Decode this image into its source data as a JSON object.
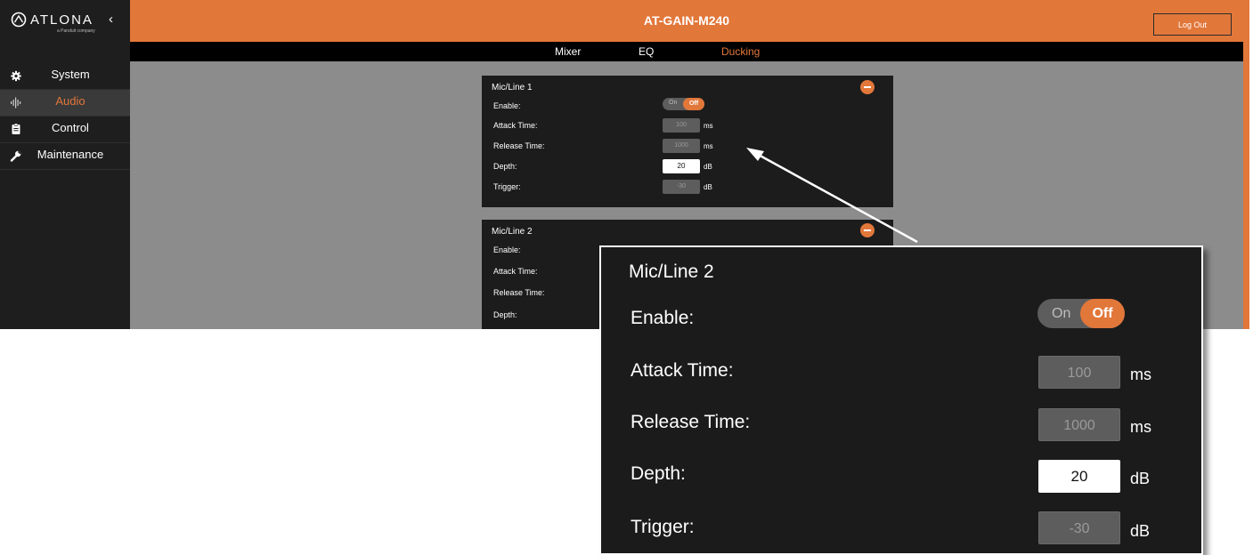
{
  "brand": {
    "logo_text": "ATLONA",
    "logo_subtitle": "a Panduit company",
    "collapse_glyph": "‹"
  },
  "header": {
    "title": "AT-GAIN-M240",
    "logout_label": "Log Out"
  },
  "sidebar": {
    "items": [
      {
        "label": "System",
        "icon": "gear-icon",
        "active": false
      },
      {
        "label": "Audio",
        "icon": "audio-waveform-icon",
        "active": true
      },
      {
        "label": "Control",
        "icon": "clipboard-icon",
        "active": false
      },
      {
        "label": "Maintenance",
        "icon": "wrench-icon",
        "active": false
      }
    ]
  },
  "tabs": [
    {
      "label": "Mixer",
      "active": false
    },
    {
      "label": "EQ",
      "active": false
    },
    {
      "label": "Ducking",
      "active": true
    }
  ],
  "channels": [
    {
      "title": "Mic/Line 1",
      "enable_label": "Enable:",
      "toggle": {
        "on": "On",
        "off": "Off",
        "state": "Off"
      },
      "attack_label": "Attack Time:",
      "attack_value": "100",
      "attack_unit": "ms",
      "release_label": "Release Time:",
      "release_value": "1000",
      "release_unit": "ms",
      "depth_label": "Depth:",
      "depth_value": "20",
      "depth_unit": "dB",
      "trigger_label": "Trigger:",
      "trigger_value": "-30",
      "trigger_unit": "dB"
    },
    {
      "title": "Mic/Line 2",
      "enable_label": "Enable:",
      "attack_label": "Attack Time:",
      "release_label": "Release Time:",
      "depth_label": "Depth:"
    }
  ],
  "zoom": {
    "title": "Mic/Line 2",
    "enable_label": "Enable:",
    "toggle": {
      "on": "On",
      "off": "Off",
      "state": "Off"
    },
    "attack_label": "Attack Time:",
    "attack_value": "100",
    "attack_unit": "ms",
    "release_label": "Release Time:",
    "release_value": "1000",
    "release_unit": "ms",
    "depth_label": "Depth:",
    "depth_value": "20",
    "depth_unit": "dB",
    "trigger_label": "Trigger:",
    "trigger_value": "-30",
    "trigger_unit": "dB"
  },
  "colors": {
    "accent": "#e2773a",
    "sidebar_bg": "#1e1e1e",
    "content_bg": "#8c8c8c",
    "card_bg": "#1c1c1c",
    "field_disabled": "#5d5d5d"
  }
}
